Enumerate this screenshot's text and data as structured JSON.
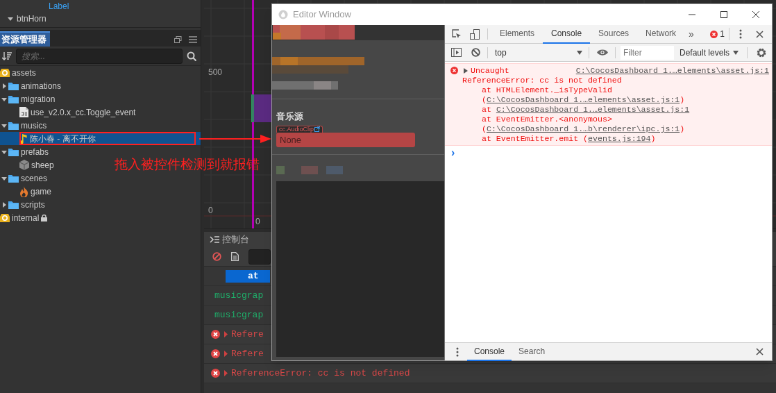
{
  "hierarchy": {
    "partial_row": "Label",
    "node": {
      "label": "btnHorn",
      "expanded": true
    }
  },
  "assets_panel": {
    "title": "资源管理器",
    "search": {
      "placeholder": "搜索..."
    },
    "tree": [
      {
        "label": "assets",
        "kind": "db",
        "selected": false,
        "children": [
          {
            "label": "animations",
            "kind": "folder",
            "expanded": false,
            "selected": false
          },
          {
            "label": "migration",
            "kind": "folder",
            "expanded": true,
            "selected": false,
            "children": [
              {
                "label": "use_v2.0.x_cc.Toggle_event",
                "kind": "script",
                "selected": false
              }
            ]
          },
          {
            "label": "musics",
            "kind": "folder",
            "expanded": true,
            "selected": false,
            "children": [
              {
                "label": "陈小春 - 离不开你",
                "kind": "audio",
                "selected": true
              }
            ]
          },
          {
            "label": "prefabs",
            "kind": "folder",
            "expanded": true,
            "selected": false,
            "children": [
              {
                "label": "sheep",
                "kind": "prefab",
                "selected": false
              }
            ]
          },
          {
            "label": "scenes",
            "kind": "folder",
            "expanded": true,
            "selected": false,
            "children": [
              {
                "label": "game",
                "kind": "scene",
                "selected": false
              }
            ]
          },
          {
            "label": "scripts",
            "kind": "folder",
            "expanded": false,
            "selected": false
          }
        ]
      },
      {
        "label": "internal",
        "kind": "db",
        "locked": true,
        "selected": false
      }
    ]
  },
  "annotation": {
    "text": "拖入被控件检测到就报错"
  },
  "scene": {
    "y_labels": [
      "500",
      "0"
    ],
    "x_label": "0"
  },
  "console_panel": {
    "title": "控制台",
    "logs": [
      {
        "kind": "highlight",
        "text": "at"
      },
      {
        "kind": "log",
        "text": "musicgrap"
      },
      {
        "kind": "log",
        "text": "musicgrap"
      },
      {
        "kind": "error",
        "text": "Refere"
      },
      {
        "kind": "error",
        "text": "Refere"
      },
      {
        "kind": "error",
        "text": "ReferenceError: cc is not defined"
      }
    ]
  },
  "editor_window": {
    "title": "Editor Window",
    "section": "音乐源",
    "asset_field": {
      "type": "cc.AudioClip",
      "value": "None"
    }
  },
  "devtools": {
    "tabs": [
      {
        "label": "Elements",
        "selected": false
      },
      {
        "label": "Console",
        "selected": true
      },
      {
        "label": "Sources",
        "selected": false
      },
      {
        "label": "Network",
        "selected": false
      }
    ],
    "more": "»",
    "error_count": "1",
    "context": "top",
    "filter_placeholder": "Filter",
    "levels": "Default levels",
    "message": {
      "summary": "Uncaught",
      "source": "C:\\CocosDashboard 1.…elements\\asset.js:1",
      "error": "ReferenceError: cc is not defined",
      "stack": [
        {
          "call": "at HTMLElement._isTypeValid (",
          "link": "C:\\CocosDashboard 1.…elements\\asset.js:1",
          "tail": ")"
        },
        {
          "call": "at ",
          "link": "C:\\CocosDashboard 1.…elements\\asset.js:1"
        },
        {
          "call": "at EventEmitter.<anonymous> (",
          "link": "C:\\CocosDashboard 1.…b\\renderer\\ipc.js:1",
          "tail": ")"
        },
        {
          "call": "at EventEmitter.emit (",
          "link": "events.js:194",
          "tail": ")"
        }
      ]
    },
    "prompt": "›",
    "drawer_tabs": [
      {
        "label": "Console",
        "selected": true
      },
      {
        "label": "Search",
        "selected": false
      }
    ]
  }
}
